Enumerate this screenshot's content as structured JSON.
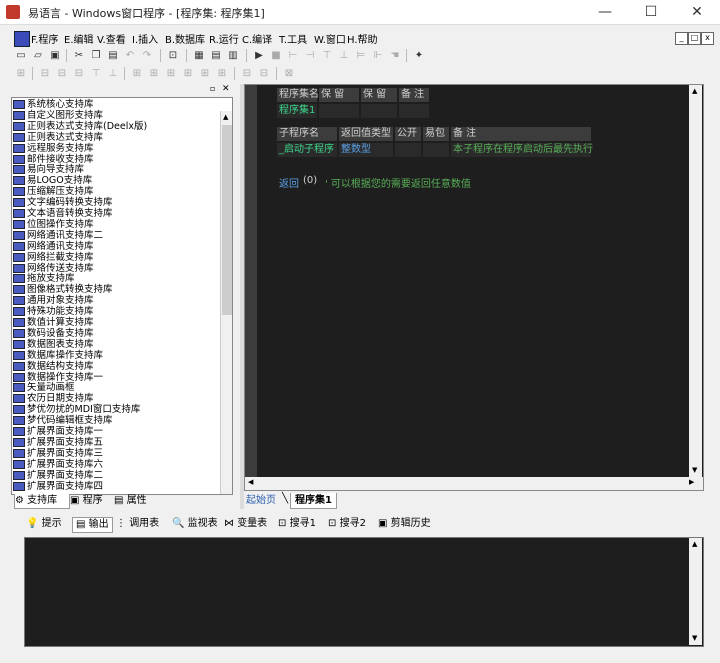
{
  "window": {
    "title": "易语言 - Windows窗口程序 - [程序集: 程序集1]",
    "controls": {
      "minimize": "—",
      "maximize": "☐",
      "close": "✕"
    }
  },
  "menu": {
    "items": [
      {
        "label": "F.程序"
      },
      {
        "label": "E.编辑"
      },
      {
        "label": "V.查看"
      },
      {
        "label": "I.插入"
      },
      {
        "label": "B.数据库"
      },
      {
        "label": "R.运行"
      },
      {
        "label": "C.编译"
      },
      {
        "label": "T.工具"
      },
      {
        "label": "W.窗口"
      },
      {
        "label": "H.帮助"
      }
    ],
    "mdi": {
      "minimize": "_",
      "restore": "□",
      "close": "x"
    }
  },
  "left_panel": {
    "libraries": [
      "系统核心支持库",
      "自定义图形支持库",
      "正则表达式支持库(Deelx版)",
      "正则表达式支持库",
      "远程服务支持库",
      "邮件接收支持库",
      "易向导支持库",
      "易LOGO支持库",
      "压缩解压支持库",
      "文字编码转换支持库",
      "文本语音转换支持库",
      "位图操作支持库",
      "网络通讯支持库二",
      "网络通讯支持库",
      "网络拦截支持库",
      "网络传送支持库",
      "拖放支持库",
      "图像格式转换支持库",
      "通用对象支持库",
      "特殊功能支持库",
      "数值计算支持库",
      "数码设备支持库",
      "数据图表支持库",
      "数据库操作支持库",
      "数据结构支持库",
      "数据操作支持库一",
      "矢量动画框",
      "农历日期支持库",
      "梦优勿扰的MDI窗口支持库",
      "梦代码编辑框支持库",
      "扩展界面支持库一",
      "扩展界面支持库五",
      "扩展界面支持库三",
      "扩展界面支持库六",
      "扩展界面支持库二",
      "扩展界面支持库四"
    ],
    "tabs": [
      {
        "label": "支持库"
      },
      {
        "label": "程序"
      },
      {
        "label": "属性"
      }
    ]
  },
  "editor": {
    "assembly_table": {
      "headers": [
        "程序集名",
        "保 留",
        "保 留",
        "备 注"
      ],
      "row": {
        "name": "程序集1",
        "r1": "",
        "r2": "",
        "note": ""
      }
    },
    "sub_table": {
      "headers": [
        "子程序名",
        "返回值类型",
        "公开",
        "易包",
        "备 注"
      ],
      "row": {
        "name": "_启动子程序",
        "ret": "整数型",
        "public": "",
        "epkg": "",
        "note": "本子程序在程序启动后最先执行"
      }
    },
    "code_line": {
      "keyword": "返回",
      "args": "(0)",
      "comment": "' 可以根据您的需要返回任意数值"
    },
    "tabs": [
      {
        "label": "起始页"
      },
      {
        "label": "程序集1"
      }
    ]
  },
  "bottom_panel": {
    "tabs": [
      {
        "label": "提示"
      },
      {
        "label": "输出"
      },
      {
        "label": "调用表"
      },
      {
        "label": "监视表"
      },
      {
        "label": "变量表"
      },
      {
        "label": "搜寻1"
      },
      {
        "label": "搜寻2"
      },
      {
        "label": "剪辑历史"
      }
    ]
  },
  "colors": {
    "editor_bg": "#1e1e1e",
    "header_cell": "#3c3c3c",
    "name_green": "#3dd68c",
    "type_blue": "#5aa0e6",
    "comment_green": "#58b058",
    "text_light": "#d0d0d0"
  },
  "icons": [
    "program-icon",
    "window-close-icon",
    "new-file-icon",
    "open-file-icon",
    "save-icon",
    "cut-icon",
    "copy-icon",
    "paste-icon",
    "undo-icon",
    "redo-icon",
    "run-icon",
    "stop-icon",
    "book-icon"
  ]
}
